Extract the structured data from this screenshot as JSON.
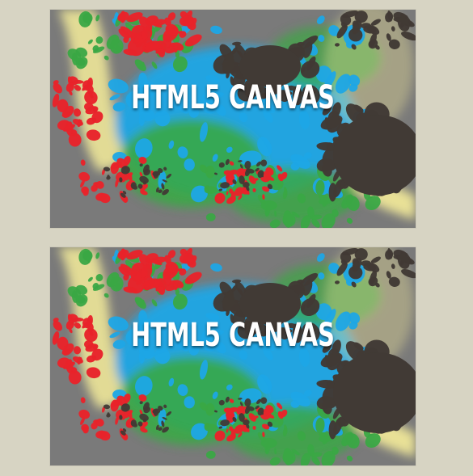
{
  "images": [
    {
      "title": "HTML5 CANVAS"
    },
    {
      "title": "HTML5 CANVAS"
    }
  ],
  "colors": {
    "page_background": "#d7d4c3",
    "canvas_gray": "#7a7a7a",
    "paint_yellow": "#f5ec9a",
    "paint_green": "#3aa845",
    "paint_blue": "#1ea6e6",
    "paint_red": "#e8232a",
    "paint_dark": "#413a35",
    "title_text": "#ffffff"
  }
}
